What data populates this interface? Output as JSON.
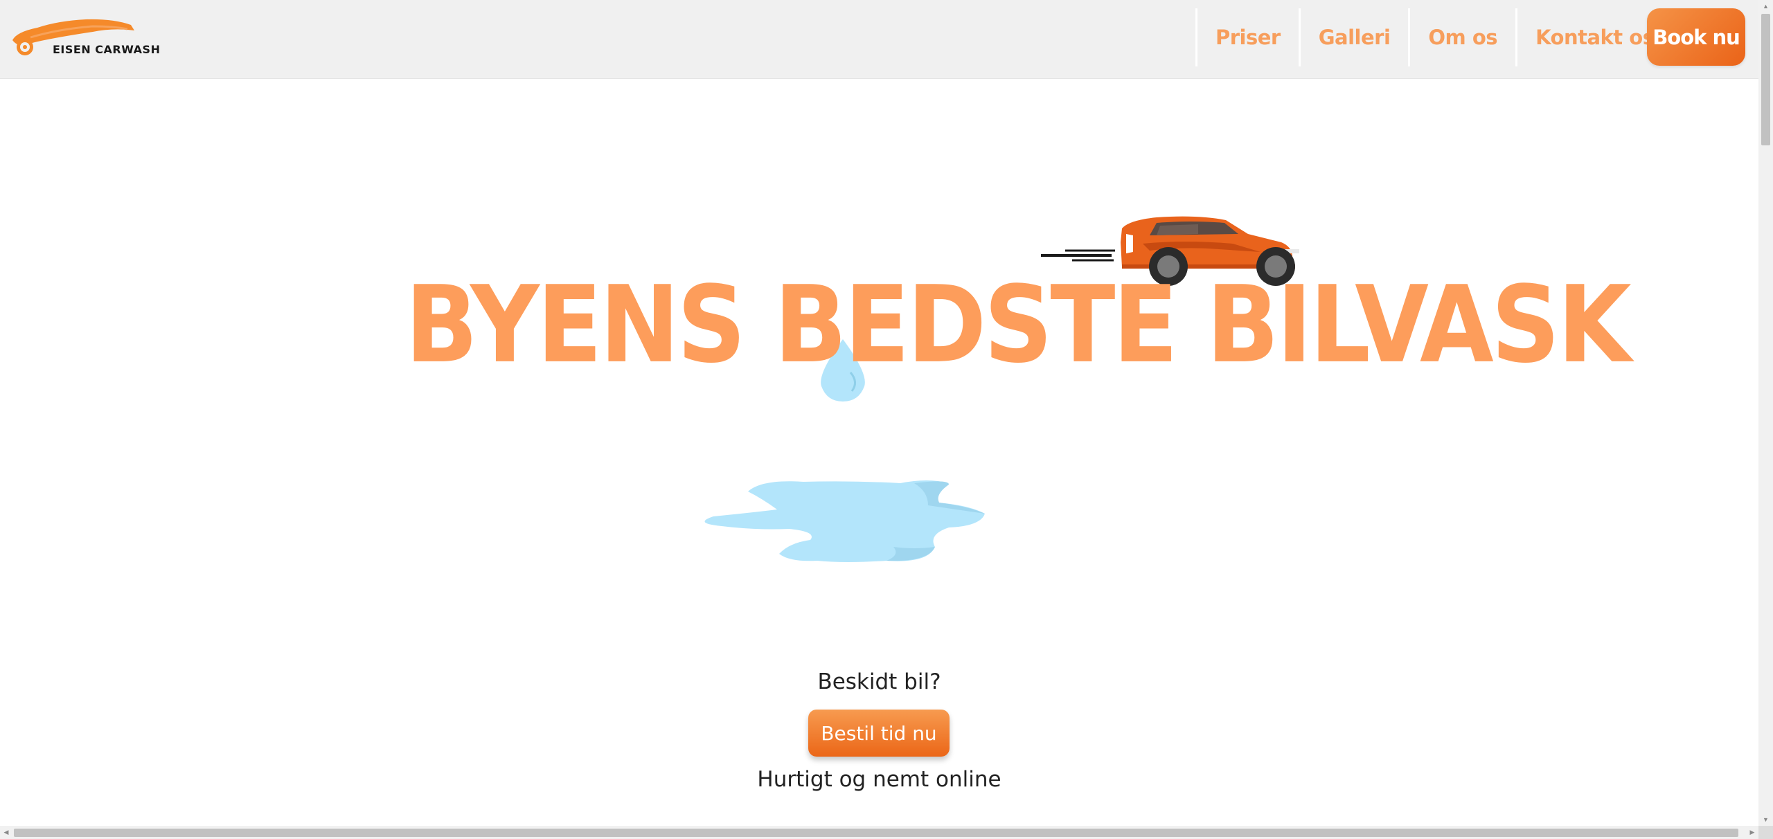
{
  "header": {
    "logo_text": "EISEN CARWASH",
    "nav": [
      {
        "label": "Priser"
      },
      {
        "label": "Galleri"
      },
      {
        "label": "Om os"
      },
      {
        "label": "Kontakt os"
      }
    ],
    "book_label": "Book nu"
  },
  "hero": {
    "headline": "BYENS BEDSTE BILVASK",
    "subtitle": "Beskidt bil?",
    "cta_label": "Bestil tid nu",
    "tagline": "Hurtigt og nemt online"
  },
  "colors": {
    "accent": "#f79e5c",
    "button_gradient_start": "#f59347",
    "button_gradient_end": "#ea6318",
    "water": "#b3e5fb",
    "car": "#e9631c",
    "header_bg": "#f0f0f0"
  },
  "icons": {
    "logo": "orange-car-logo",
    "car": "orange-sports-car",
    "drop": "water-drop",
    "puddle": "water-puddle"
  }
}
